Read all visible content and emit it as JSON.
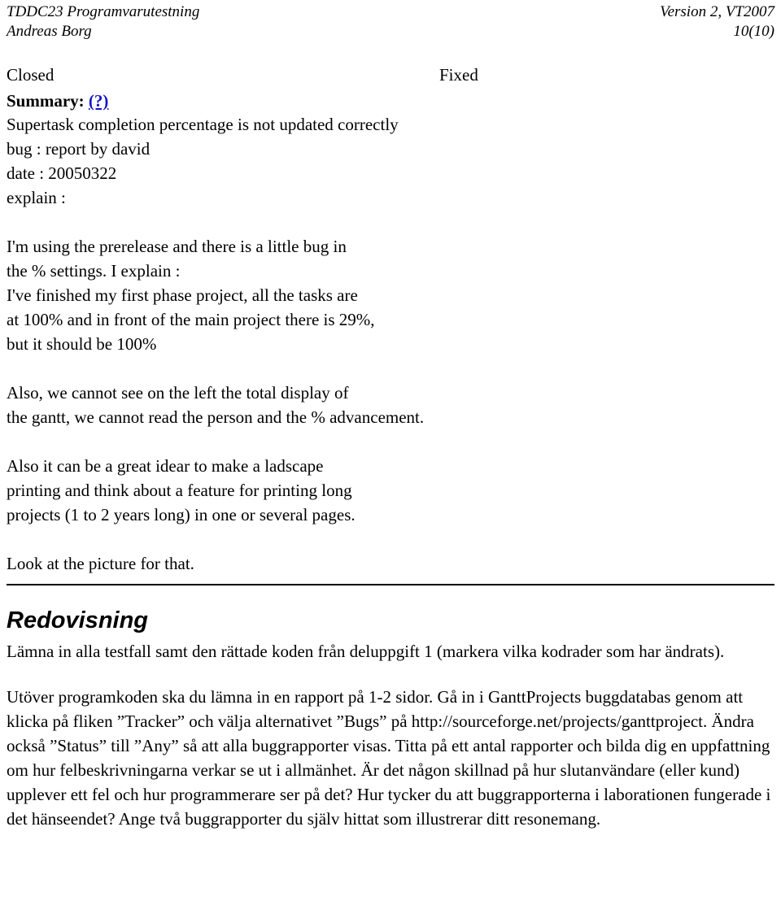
{
  "header": {
    "course": "TDDC23 Programvarutestning",
    "version": "Version 2, VT2007",
    "author": "Andreas Borg",
    "page": "10(10)"
  },
  "bug_report": {
    "status": "Closed",
    "resolution": "Fixed",
    "summary_label": "Summary:",
    "summary_link": "(?)",
    "summary_text": "Supertask completion percentage is not updated correctly",
    "bug_line": "bug : report by david",
    "date_line": "date : 20050322",
    "explain_line": "explain :",
    "paragraph1": [
      "I'm using the prerelease and there is a little bug in",
      "the % settings. I explain :",
      "I've finished my first phase project, all the tasks are",
      "at 100% and in front of the main project there is 29%,",
      "but it should be 100%"
    ],
    "paragraph2": [
      "Also, we cannot see on the left the total display of",
      "the gantt, we cannot read the person and the % advancement."
    ],
    "paragraph3": [
      "Also it can be a great idear to make a ladscape",
      "printing and think about a feature for printing long",
      "projects (1 to 2 years long) in one or several pages."
    ],
    "paragraph4": "Look at the picture for that."
  },
  "redovisning": {
    "title": "Redovisning",
    "paragraph1": "Lämna in alla testfall samt den rättade koden från deluppgift 1 (markera vilka kodrader som har ändrats).",
    "paragraph2": "Utöver programkoden ska du lämna in en rapport på 1-2 sidor. Gå in i GanttProjects buggdatabas genom att klicka på fliken ”Tracker” och välja alternativet ”Bugs” på http://sourceforge.net/projects/ganttproject. Ändra också ”Status” till ”Any” så att alla buggrapporter visas. Titta på ett antal rapporter och bilda dig en uppfattning om hur felbeskrivningarna verkar se ut i allmänhet. Är det någon skillnad på hur slutanvändare (eller kund) upplever ett fel och hur programmerare ser på det? Hur tycker du att buggrapporterna i laborationen fungerade i det hänseendet? Ange två buggrapporter du själv hittat som illustrerar ditt resonemang."
  },
  "colors": {
    "link": "#1414c8",
    "text": "#000000",
    "background": "#ffffff"
  }
}
